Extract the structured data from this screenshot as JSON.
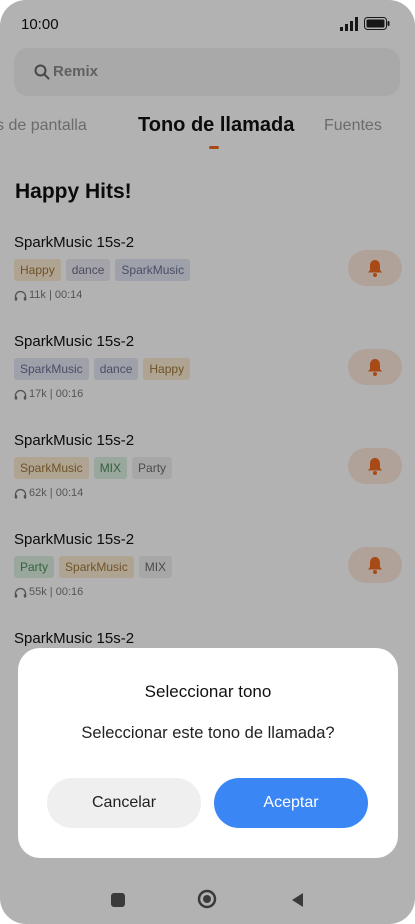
{
  "status": {
    "time": "10:00"
  },
  "search": {
    "placeholder": "Remix"
  },
  "tabs": {
    "left": "s de pantalla",
    "active": "Tono de llamada",
    "right": "Fuentes"
  },
  "section": {
    "title": "Happy Hits!"
  },
  "songs": [
    {
      "title": "SparkMusic 15s-2",
      "tags": [
        "Happy",
        "dance",
        "SparkMusic"
      ],
      "meta": "11k | 00:14"
    },
    {
      "title": "SparkMusic 15s-2",
      "tags": [
        "SparkMusic",
        "dance",
        "Happy"
      ],
      "meta": "17k | 00:16"
    },
    {
      "title": "SparkMusic 15s-2",
      "tags": [
        "SparkMusic",
        "MIX",
        "Party"
      ],
      "meta": "62k | 00:14"
    },
    {
      "title": "SparkMusic 15s-2",
      "tags": [
        "Party",
        "SparkMusic",
        "MIX"
      ],
      "meta": "55k | 00:16"
    },
    {
      "title": "SparkMusic 15s-2"
    }
  ],
  "dialog": {
    "title": "Seleccionar tono",
    "message": "Seleccionar este tono de llamada?",
    "cancel_label": "Cancelar",
    "ok_label": "Aceptar"
  },
  "colors": {
    "accent": "#f06a20",
    "primary_button": "#3b86f5"
  },
  "icons": [
    "search-icon",
    "headphones-icon",
    "bell-icon",
    "signal-icon",
    "battery-icon",
    "recents-icon",
    "home-icon",
    "back-icon"
  ]
}
